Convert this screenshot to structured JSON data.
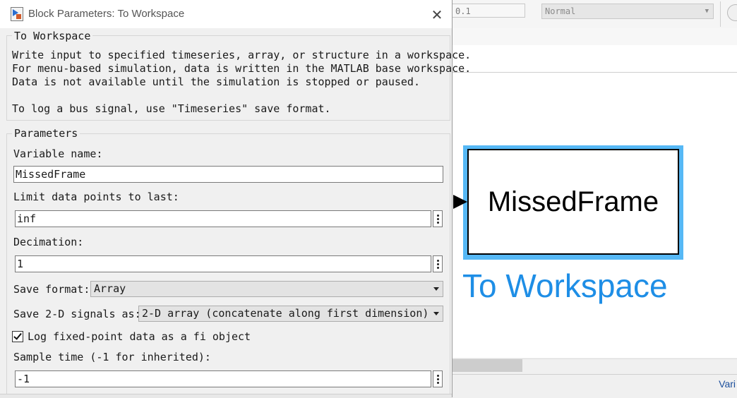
{
  "background": {
    "stop_time": "0.1",
    "sim_mode": "Normal",
    "status_right": "Vari",
    "block": {
      "name": "MissedFrame",
      "label": "To Workspace",
      "highlight_color": "#56b8f5",
      "label_color": "#1e8ee6"
    }
  },
  "dialog": {
    "title": "Block Parameters: To Workspace",
    "close_symbol": "✕",
    "block_group": {
      "legend": "To Workspace",
      "description": "Write input to specified timeseries, array, or structure in a workspace.\nFor menu-based simulation, data is written in the MATLAB base workspace.\nData is not available until the simulation is stopped or paused.\n\nTo log a bus signal, use \"Timeseries\" save format."
    },
    "parameters": {
      "legend": "Parameters",
      "variable_name": {
        "label": "Variable name:",
        "value": "MissedFrame"
      },
      "limit_points": {
        "label": "Limit data points to last:",
        "value": "inf"
      },
      "decimation": {
        "label": "Decimation:",
        "value": "1"
      },
      "save_format": {
        "label": "Save format:",
        "value": "Array"
      },
      "save_2d": {
        "label": "Save 2-D signals as:",
        "value": "2-D array (concatenate along first dimension)"
      },
      "log_fixed_point": {
        "label": "Log fixed-point data as a fi object",
        "checked": true
      },
      "sample_time": {
        "label": "Sample time (-1 for inherited):",
        "value": "-1"
      }
    }
  }
}
